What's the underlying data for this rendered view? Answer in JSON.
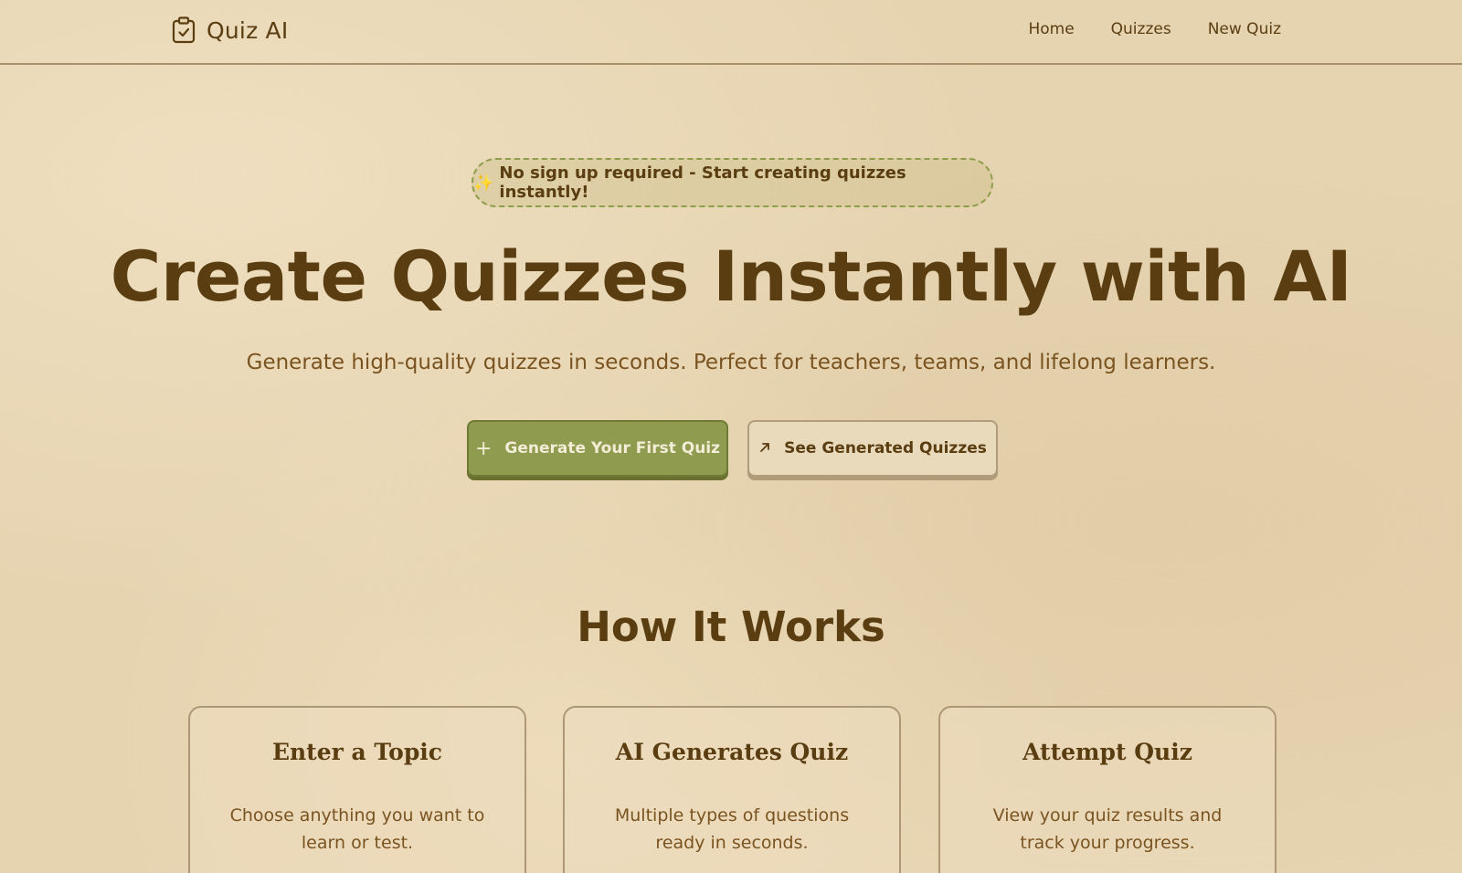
{
  "nav": {
    "brand": "Quiz AI",
    "brand_icon": "clipboard-check-icon",
    "links": [
      "Home",
      "Quizzes",
      "New Quiz"
    ]
  },
  "hero": {
    "badge_icon": "✨",
    "badge_text": "No sign up required - Start creating quizzes instantly!",
    "title": "Create Quizzes Instantly with AI",
    "subtitle": "Generate high-quality quizzes in seconds. Perfect for teachers, teams, and lifelong learners.",
    "primary_button": "Generate Your First Quiz",
    "secondary_button": "See Generated Quizzes"
  },
  "how_it_works": {
    "title": "How It Works",
    "cards": [
      {
        "title": "Enter a Topic",
        "description": "Choose anything you want to learn or test."
      },
      {
        "title": "AI Generates Quiz",
        "description": "Multiple types of questions ready in seconds."
      },
      {
        "title": "Attempt Quiz",
        "description": "View your quiz results and track your progress."
      }
    ]
  },
  "colors": {
    "background": "#e6d3b0",
    "text": "#5a3e12",
    "accent": "#8f9b4f"
  }
}
